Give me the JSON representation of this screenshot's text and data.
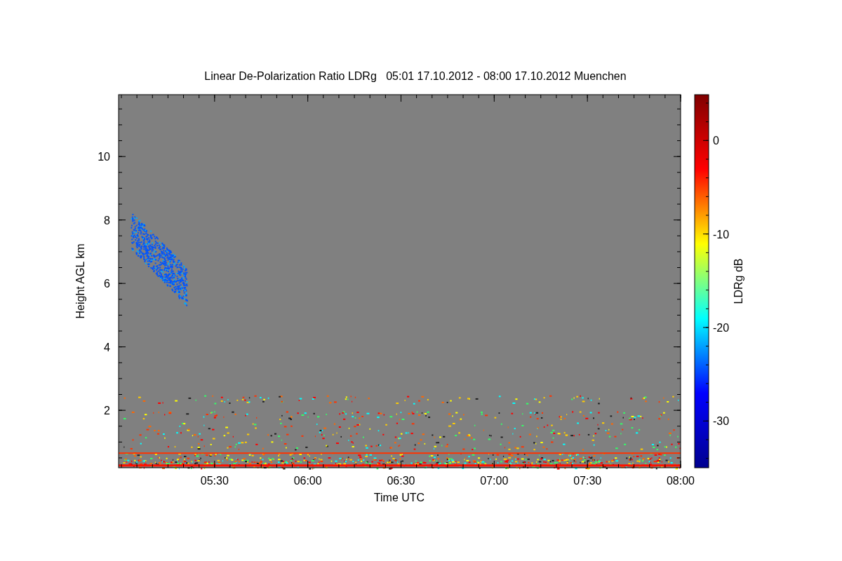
{
  "title": "Linear De-Polarization Ratio LDRg   05:01 17.10.2012 - 08:00 17.10.2012 Muenchen",
  "xaxis": {
    "label": "Time UTC",
    "ticks": [
      "05:30",
      "06:00",
      "06:30",
      "07:00",
      "07:30",
      "08:00"
    ]
  },
  "yaxis": {
    "label": "Height AGL km",
    "ticks": [
      "10",
      "8",
      "6",
      "4",
      "2"
    ]
  },
  "colorbar": {
    "label": "LDRg dB",
    "ticks": [
      "0",
      "-10",
      "-20",
      "-30"
    ]
  }
}
